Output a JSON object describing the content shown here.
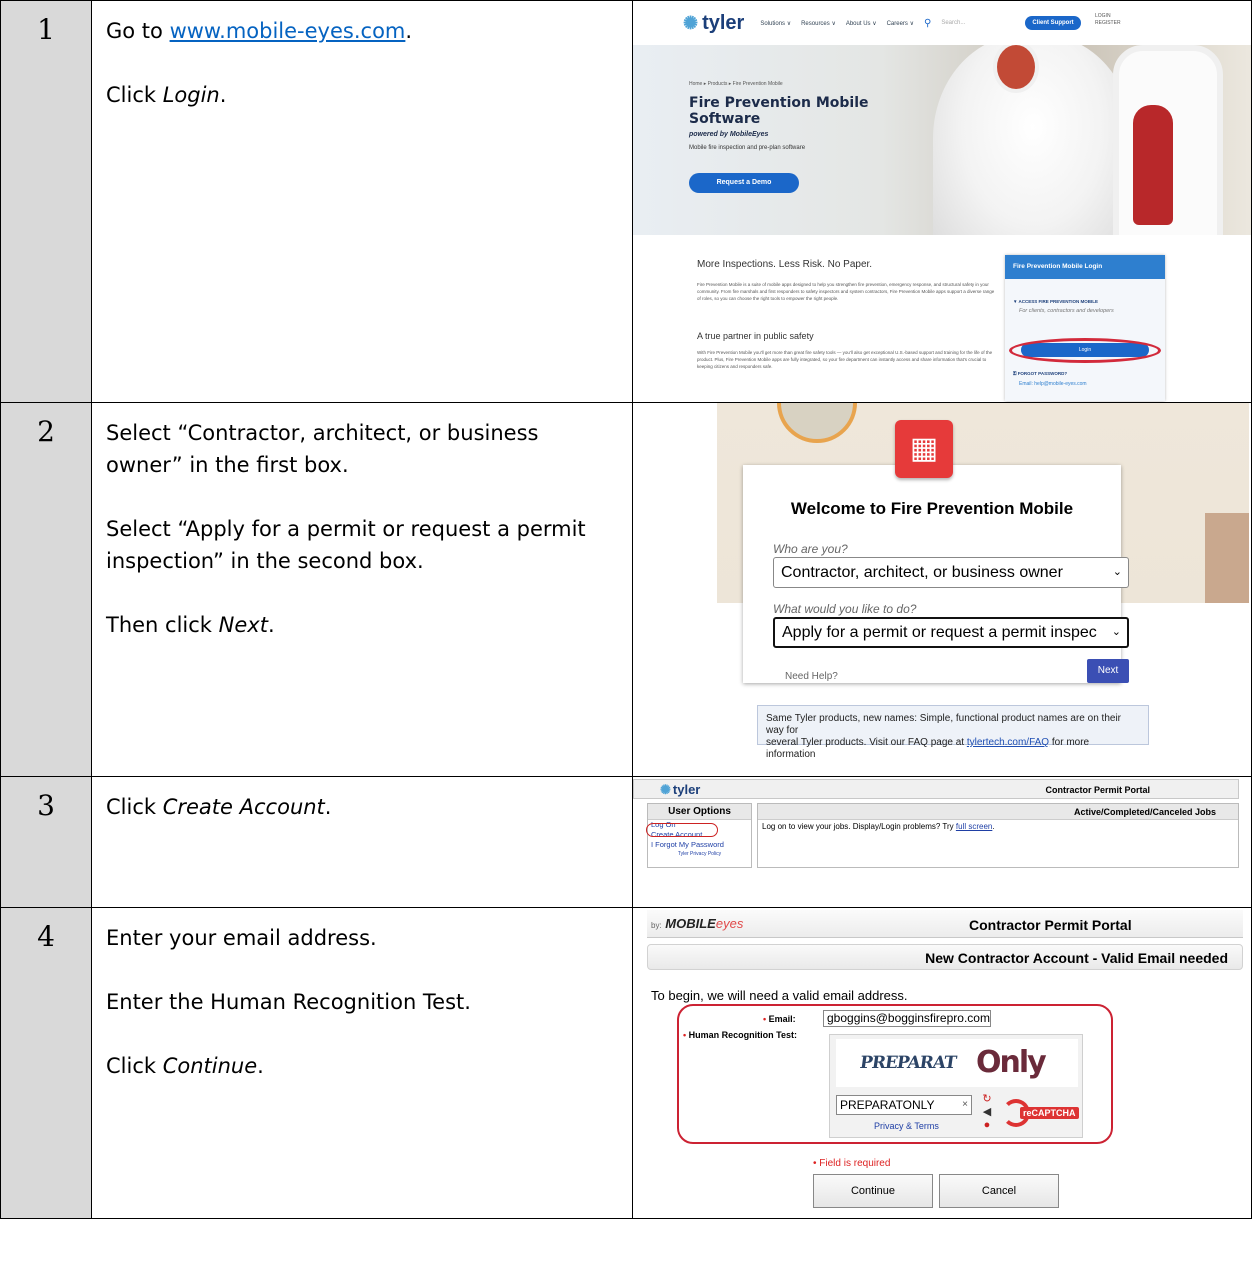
{
  "steps": [
    {
      "number": "1",
      "link_text": "www.mobile-eyes.com",
      "line1_prefix": "Go to ",
      "line1_suffix": ".",
      "line2_prefix": "Click ",
      "line2_emph": "Login",
      "line2_suffix": "."
    },
    {
      "number": "2",
      "line1": "Select “Contractor, architect, or business owner” in the first box.",
      "line2": "Select “Apply for a permit or request a permit inspection” in the second box.",
      "line3_prefix": "Then click ",
      "line3_emph": "Next",
      "line3_suffix": "."
    },
    {
      "number": "3",
      "line1_prefix": "Click ",
      "line1_emph": "Create Account",
      "line1_suffix": "."
    },
    {
      "number": "4",
      "line1": "Enter your email address.",
      "line2": "Enter the Human Recognition Test.",
      "line3_prefix": "Click ",
      "line3_emph": "Continue",
      "line3_suffix": "."
    }
  ],
  "shot1": {
    "brand": "tyler",
    "nav": [
      "Solutions ∨",
      "Resources ∨",
      "About Us ∨",
      "Careers ∨",
      "Search..."
    ],
    "client_support": "Client Support",
    "login_top": "LOGIN",
    "register_top": "REGISTER",
    "breadcrumb": "Home ▸ Products ▸ Fire Prevention Mobile",
    "title_line1": "Fire Prevention Mobile",
    "title_line2": "Software",
    "powered": "powered by MobileEyes",
    "subtitle": "Mobile fire inspection and pre-plan software",
    "demo_button": "Request a Demo",
    "heading": "More Inspections. Less Risk. No Paper.",
    "para1": "Fire Prevention Mobile is a suite of mobile apps designed to help you strengthen fire prevention, emergency response, and structural safety in your community. From fire marshals and first responders to safety inspectors and system contractors, Fire Prevention Mobile apps support a diverse range of roles, so you can choose the right tools to empower the right people.",
    "heading2": "A true partner in public safety",
    "para2": "With Fire Prevention Mobile you'll get more than great fire safety tools — you'll also get exceptional U.S.-based support and training for the life of the product. Plus, Fire Prevention Mobile apps are fully integrated, so your fire department can instantly access and share information that's crucial to keeping citizens and responders safe.",
    "card_title": "Fire Prevention Mobile Login",
    "access": "ACCESS FIRE PREVENTION MOBILE",
    "access_sub": "For clients, contractors and developers",
    "login_button": "Login",
    "forgot": "FORGOT PASSWORD?",
    "email": "Email: help@mobile-eyes.com"
  },
  "shot2": {
    "title": "Welcome to Fire Prevention Mobile",
    "who_label": "Who are you?",
    "who_value": "Contractor, architect, or business owner",
    "what_label": "What would you like to do?",
    "what_value": "Apply for a permit or request a permit inspec",
    "help": "Need Help?",
    "next": "Next",
    "notice_line1": "Same Tyler products, new names: Simple, functional product names are on their way for",
    "notice_pre": "several Tyler products. Visit our FAQ page at ",
    "notice_link": "tylertech.com/FAQ",
    "notice_post": " for more information"
  },
  "shot3": {
    "brand": "tyler",
    "portal": "Contractor Permit Portal",
    "user_options": "User Options",
    "links": [
      "Log On",
      "Create Account",
      "I Forgot My Password"
    ],
    "privacy": "Tyler Privacy Policy",
    "jobs_header": "Active/Completed/Canceled Jobs",
    "msg_pre": "Log on to view your jobs. Display/Login problems? Try ",
    "msg_link": "full screen",
    "msg_post": "."
  },
  "shot4": {
    "by": "by:",
    "brand": "MOBILE",
    "brand_suffix": "eyes",
    "portal": "Contractor Permit Portal",
    "subtitle": "New Contractor Account - Valid Email needed",
    "intro": "To begin, we will need a valid email address.",
    "email_label": "Email:",
    "email_value": "gboggins@bogginsfirepro.com",
    "hrt_label": "Human Recognition Test:",
    "captcha_word1": "PREPARAT",
    "captcha_word2": "Only",
    "captcha_value": "PREPARATONLY",
    "privacy_terms": "Privacy & Terms",
    "recaptcha": "reCAPTCHA",
    "error": "Field is required",
    "continue": "Continue",
    "cancel": "Cancel"
  },
  "colors": {
    "accent_blue": "#1b67c9",
    "highlight_red": "#d22a3b",
    "number_cell": "#d9d9d9",
    "link": "#0563c1"
  }
}
